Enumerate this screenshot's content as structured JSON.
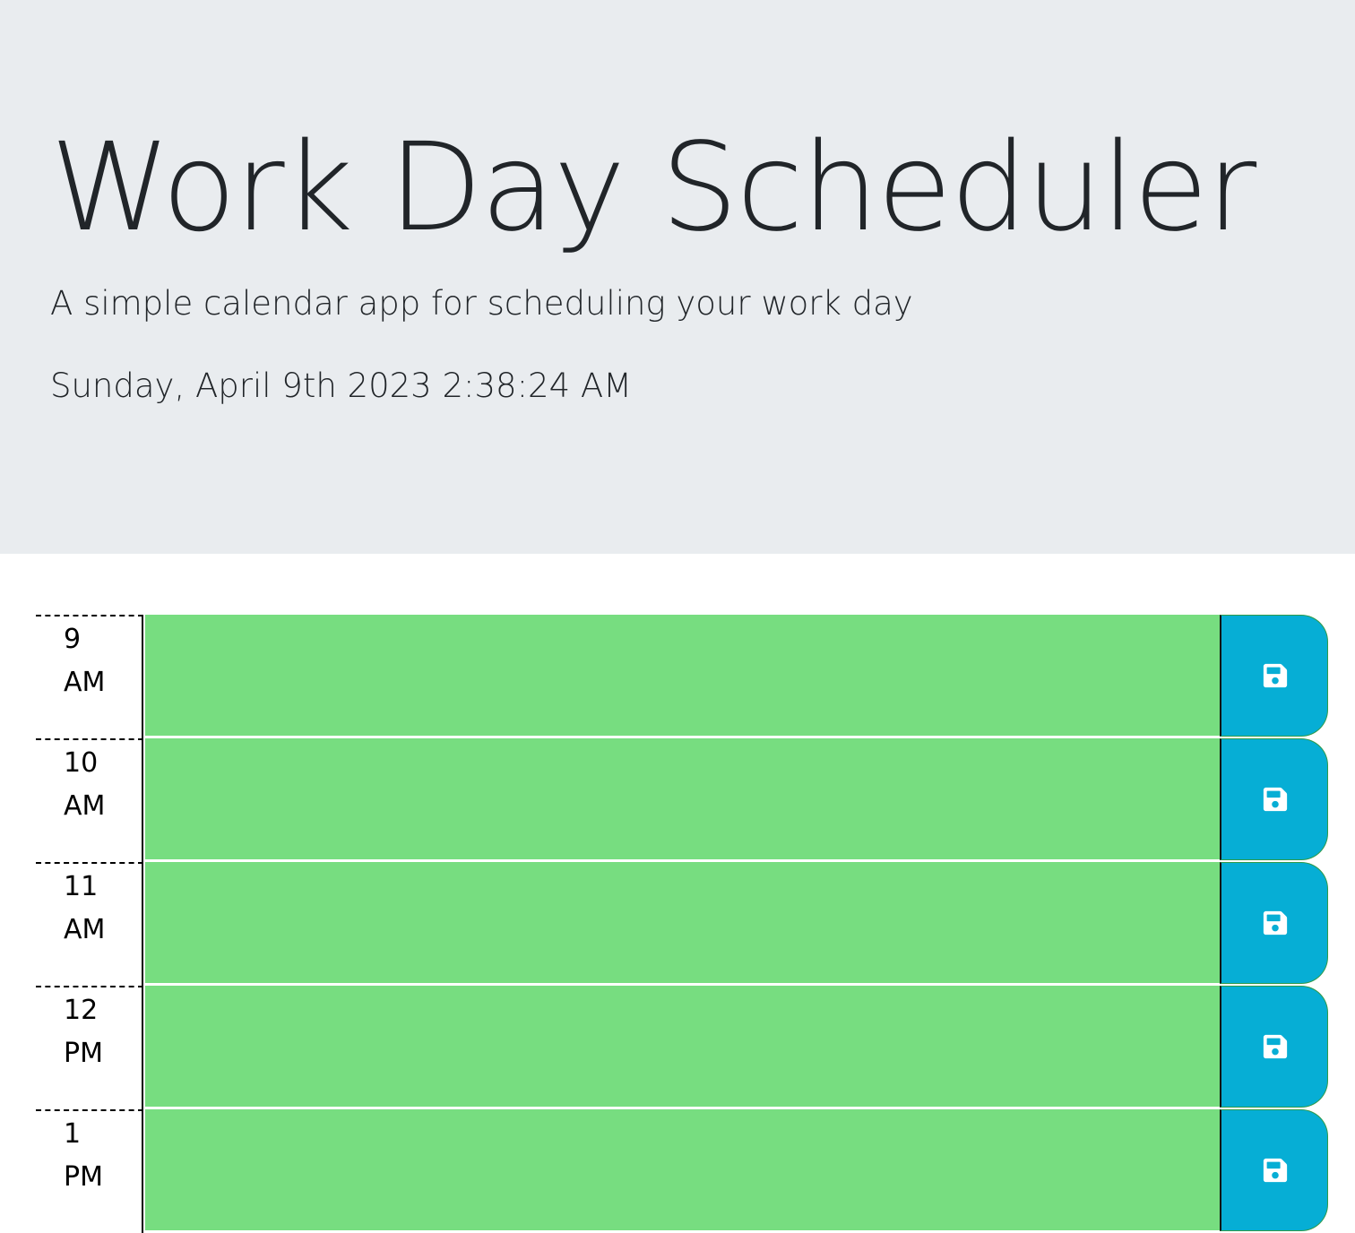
{
  "header": {
    "title": "Work Day Scheduler",
    "lead": "A simple calendar app for scheduling your work day",
    "current_day": "Sunday, April 9th 2023 2:38:24 AM"
  },
  "colors": {
    "jumbotron_bg": "#e9ecef",
    "future_block": "#77dd80",
    "save_button": "#06aed5",
    "save_icon": "#ffffff"
  },
  "time_blocks": [
    {
      "hour": "9",
      "ampm": "AM",
      "description": "",
      "status": "future",
      "save_icon": "floppy-disk-icon"
    },
    {
      "hour": "10",
      "ampm": "AM",
      "description": "",
      "status": "future",
      "save_icon": "floppy-disk-icon"
    },
    {
      "hour": "11",
      "ampm": "AM",
      "description": "",
      "status": "future",
      "save_icon": "floppy-disk-icon"
    },
    {
      "hour": "12",
      "ampm": "PM",
      "description": "",
      "status": "future",
      "save_icon": "floppy-disk-icon"
    },
    {
      "hour": "1",
      "ampm": "PM",
      "description": "",
      "status": "future",
      "save_icon": "floppy-disk-icon"
    }
  ]
}
